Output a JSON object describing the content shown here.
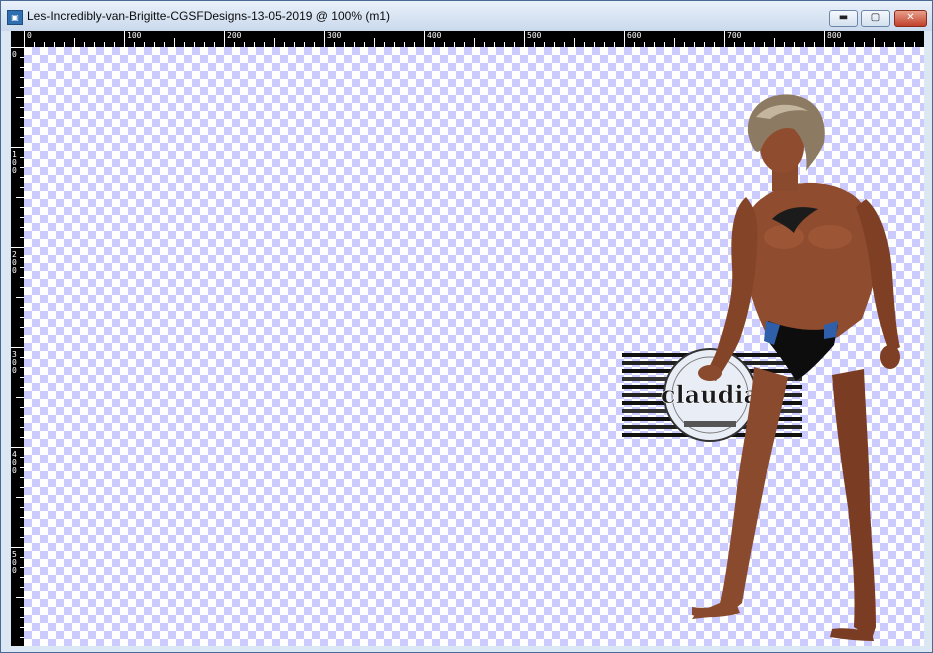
{
  "window": {
    "title": "Les-Incredibly-van-Brigitte-CGSFDesigns-13-05-2019 @ 100% (m1)",
    "app_icon": "psp-image-icon",
    "buttons": {
      "minimize": "▬",
      "maximize": "▢",
      "close": "✕"
    }
  },
  "ruler": {
    "top_labels": [
      "0",
      "100",
      "200",
      "300",
      "400",
      "500",
      "600",
      "700",
      "800"
    ],
    "left_labels": [
      "0",
      "100",
      "200",
      "300",
      "400",
      "500"
    ]
  },
  "watermark": {
    "text": "claudia"
  },
  "colors": {
    "checker": "#cbcbff",
    "skin": "#8a4a2e",
    "hair": "#8c7a62",
    "brief_blue": "#2f5fa8"
  }
}
